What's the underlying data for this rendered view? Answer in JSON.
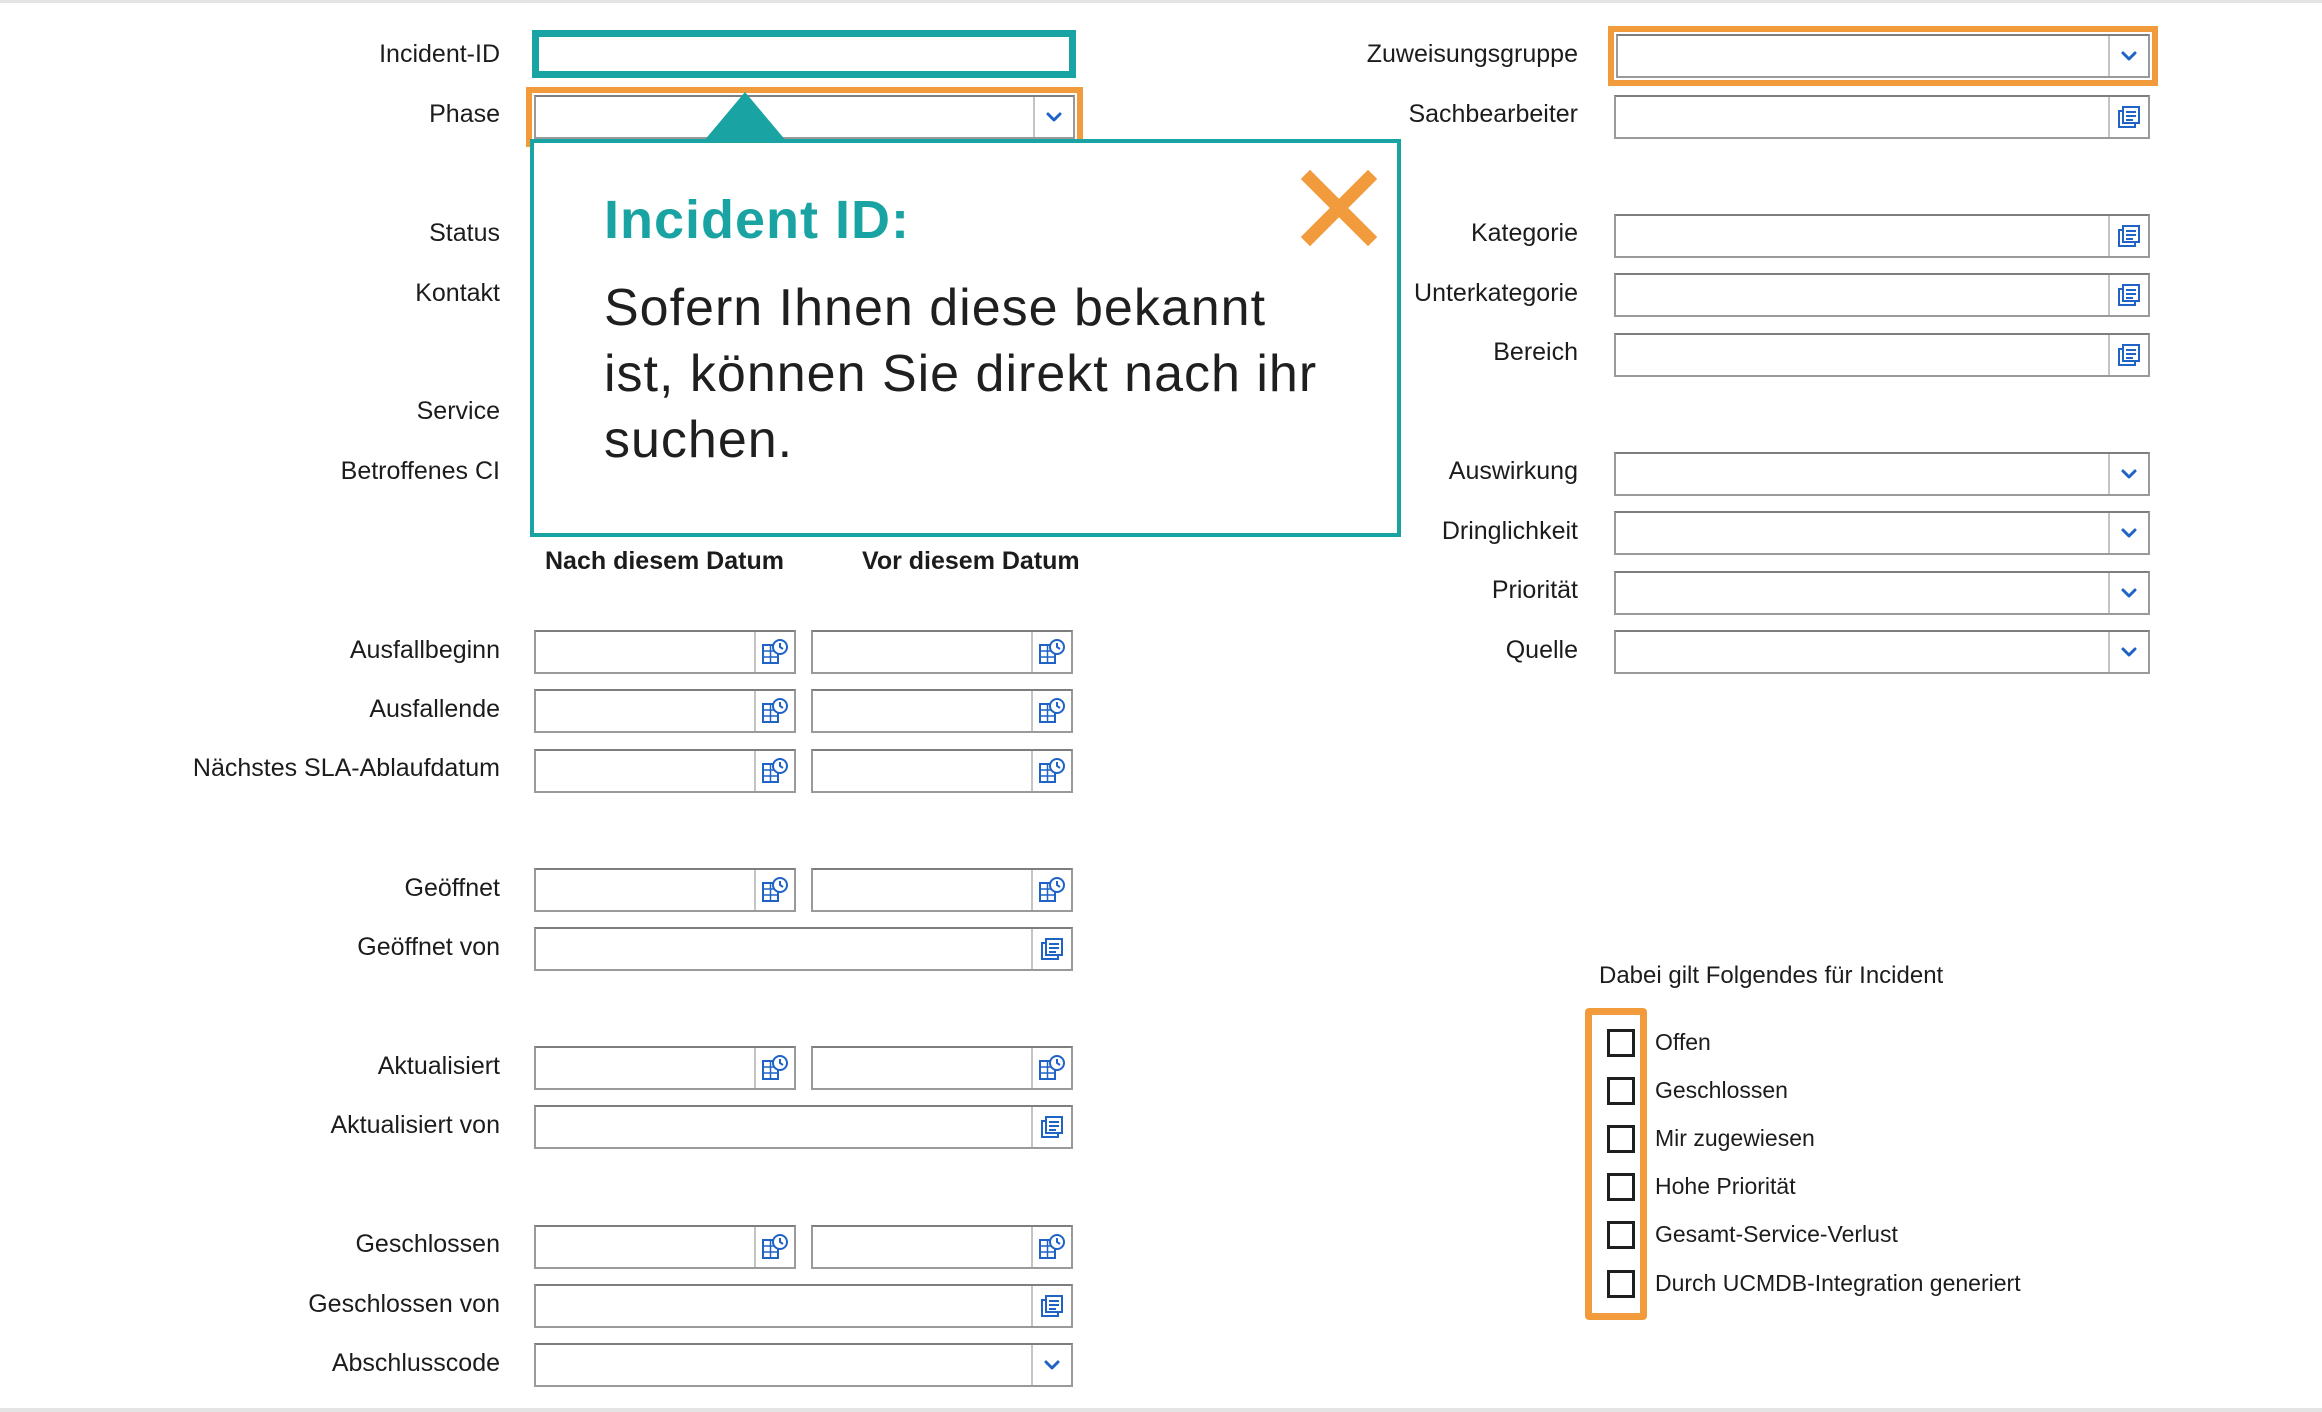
{
  "colors": {
    "accent_teal": "#1aa3a3",
    "highlight_orange": "#f29b3c"
  },
  "left_form": {
    "incident_id_label": "Incident-ID",
    "phase_label": "Phase",
    "status_label": "Status",
    "kontakt_label": "Kontakt",
    "service_label": "Service",
    "betroffenes_ci_label": "Betroffenes CI",
    "col_after": "Nach diesem Datum",
    "col_before": "Vor diesem Datum",
    "ausfallbeginn_label": "Ausfallbeginn",
    "ausfallende_label": "Ausfallende",
    "sla_label": "Nächstes SLA-Ablaufdatum",
    "geoeffnet_label": "Geöffnet",
    "geoeffnet_von_label": "Geöffnet von",
    "aktualisiert_label": "Aktualisiert",
    "aktualisiert_von_label": "Aktualisiert von",
    "geschlossen_label": "Geschlossen",
    "geschlossen_von_label": "Geschlossen von",
    "abschlusscode_label": "Abschlusscode"
  },
  "right_form": {
    "zuweisungsgruppe_label": "Zuweisungsgruppe",
    "sachbearbeiter_label": "Sachbearbeiter",
    "kategorie_label": "Kategorie",
    "unterkategorie_label": "Unterkategorie",
    "bereich_label": "Bereich",
    "auswirkung_label": "Auswirkung",
    "dringlichkeit_label": "Dringlichkeit",
    "prioritaet_label": "Priorität",
    "quelle_label": "Quelle"
  },
  "filters": {
    "heading": "Dabei gilt Folgendes für Incident",
    "items": [
      {
        "label": "Offen",
        "checked": false
      },
      {
        "label": "Geschlossen",
        "checked": false
      },
      {
        "label": "Mir zugewiesen",
        "checked": false
      },
      {
        "label": "Hohe Priorität",
        "checked": false
      },
      {
        "label": "Gesamt-Service-Verlust",
        "checked": false
      },
      {
        "label": "Durch UCMDB-Integration generiert",
        "checked": false
      }
    ]
  },
  "tooltip": {
    "title": "Incident ID:",
    "body": "Sofern Ihnen diese bekannt ist, können Sie direkt nach ihr suchen.",
    "close_icon": "close-x-icon"
  },
  "icons": {
    "dropdown": "chevron-down-icon",
    "lookup": "lookup-list-icon",
    "datetime": "calendar-clock-icon"
  }
}
